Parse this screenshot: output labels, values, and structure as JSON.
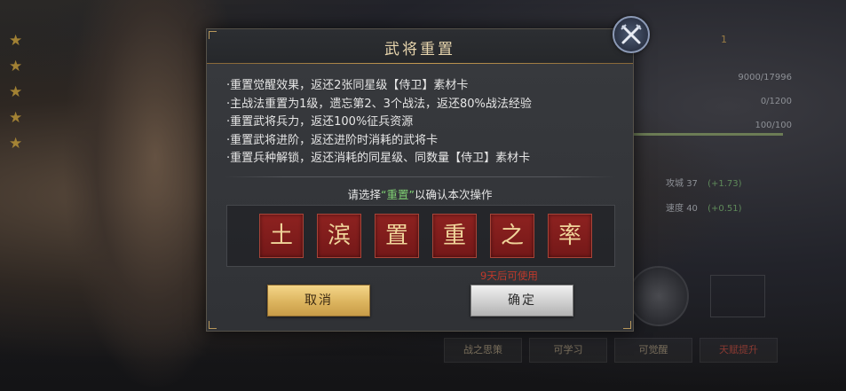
{
  "background": {
    "side_values": [
      "9000/17996",
      "0/1200",
      "100/100"
    ],
    "stats": [
      {
        "label": "攻城",
        "value": "37",
        "bonus": "(+1.73)"
      },
      {
        "label": "速度",
        "value": "40",
        "bonus": "(+0.51)"
      }
    ],
    "level_hint": "1",
    "tabs": [
      "战之思策",
      "可学习",
      "可觉醒",
      "天赋提升"
    ]
  },
  "dialog": {
    "title": "武将重置",
    "rules": [
      "·重置觉醒效果，返还2张同星级【侍卫】素材卡",
      "·主战法重置为1级，遗忘第2、3个战法，返还80%战法经验",
      "·重置武将兵力，返还100%征兵资源",
      "·重置武将进阶，返还进阶时消耗的武将卡",
      "·重置兵种解锁，返还消耗的同星级、同数量【侍卫】素材卡"
    ],
    "prompt_before": "请选择",
    "prompt_highlight": "“重置”",
    "prompt_after": "以确认本次操作",
    "characters": [
      "土",
      "滨",
      "置",
      "重",
      "之",
      "率"
    ],
    "cooldown_text": "9天后可使用",
    "cancel_label": "取消",
    "confirm_label": "确定"
  },
  "colors": {
    "accent_gold": "#e8d6ae",
    "char_tile": "#8e2220",
    "highlight_green": "#7fcf73",
    "warning_red": "#c0392b"
  },
  "icons": {
    "close": "crossed-swords-icon",
    "background_rank": "star-icon"
  }
}
